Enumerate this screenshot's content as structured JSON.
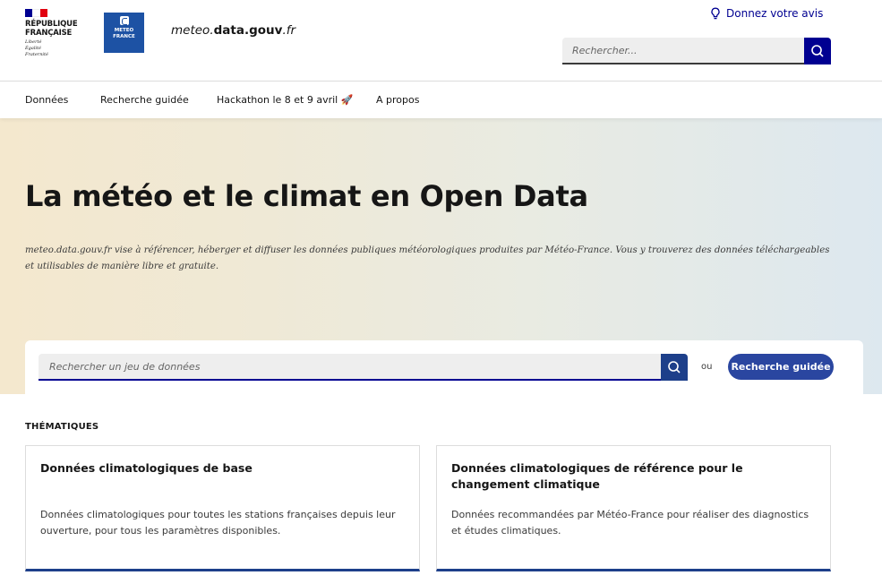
{
  "header": {
    "republic_name_line1": "RÉPUBLIQUE",
    "republic_name_line2": "FRANÇAISE",
    "motto_line1": "Liberté",
    "motto_line2": "Égalité",
    "motto_line3": "Fraternité",
    "meteo_logo_line1": "METEO",
    "meteo_logo_line2": "FRANCE",
    "site_name_part1": "meteo.",
    "site_name_part2": "data.gouv",
    "site_name_part3": ".fr",
    "feedback_label": "Donnez votre avis",
    "search_placeholder": "Rechercher..."
  },
  "nav": {
    "items": [
      {
        "label": "Données"
      },
      {
        "label": "Recherche guidée"
      },
      {
        "label": "Hackathon le 8 et 9 avril 🚀"
      },
      {
        "label": "A propos"
      }
    ]
  },
  "hero": {
    "title": "La météo et le climat en Open Data",
    "description": "meteo.data.gouv.fr vise à référencer, héberger et diffuser les données publiques météorologiques produites par Météo-France. Vous y trouverez des données téléchargeables et utilisables de manière libre et gratuite.",
    "search_placeholder": "Rechercher un jeu de données",
    "or_label": "ou",
    "guided_search_label": "Recherche guidée"
  },
  "thematics": {
    "section_title": "THÉMATIQUES",
    "cards": [
      {
        "title": "Données climatologiques de base",
        "description": "Données climatologiques pour toutes les stations françaises depuis leur ouverture, pour tous les paramètres disponibles."
      },
      {
        "title": "Données climatologiques de référence pour le changement climatique",
        "description": "Données recommandées par Météo-France pour réaliser des diagnostics et études climatiques."
      }
    ]
  },
  "colors": {
    "primary_blue": "#000091",
    "button_blue": "#2a46a0",
    "card_border_accent": "#1d3f8a",
    "marianne_red": "#e1000f"
  }
}
